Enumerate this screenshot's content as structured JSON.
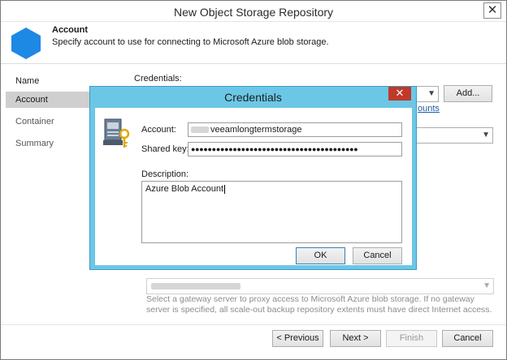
{
  "window": {
    "title": "New Object Storage Repository",
    "close_glyph": "✕"
  },
  "header": {
    "title": "Account",
    "description": "Specify account to use for connecting to Microsoft Azure blob storage.",
    "icon": "azure-hexagon-icon",
    "icon_color": "#1e88e5"
  },
  "nav": {
    "items": [
      {
        "label": "Name"
      },
      {
        "label": "Account"
      },
      {
        "label": "Container"
      },
      {
        "label": "Summary"
      }
    ],
    "active_index": 1
  },
  "main": {
    "credentials_label": "Credentials:",
    "add_button": "Add...",
    "manage_link_fragment": "ounts",
    "gateway_hint": "Select a gateway server to proxy access to Microsoft Azure blob storage. If no gateway server is specified, all scale-out backup repository extents must have direct Internet access."
  },
  "footer": {
    "previous": "< Previous",
    "next": "Next >",
    "finish": "Finish",
    "cancel": "Cancel"
  },
  "dialog": {
    "title": "Credentials",
    "close_glyph": "✕",
    "account_label": "Account:",
    "account_value": "veeamlongtermstorage",
    "shared_key_label": "Shared key:",
    "shared_key_value": "●●●●●●●●●●●●●●●●●●●●●●●●●●●●●●●●●●●●●●●●",
    "description_label": "Description:",
    "description_value": "Azure Blob Account",
    "ok": "OK",
    "cancel": "Cancel",
    "close_color": "#c0392b",
    "frame_color": "#6cc7e6"
  }
}
